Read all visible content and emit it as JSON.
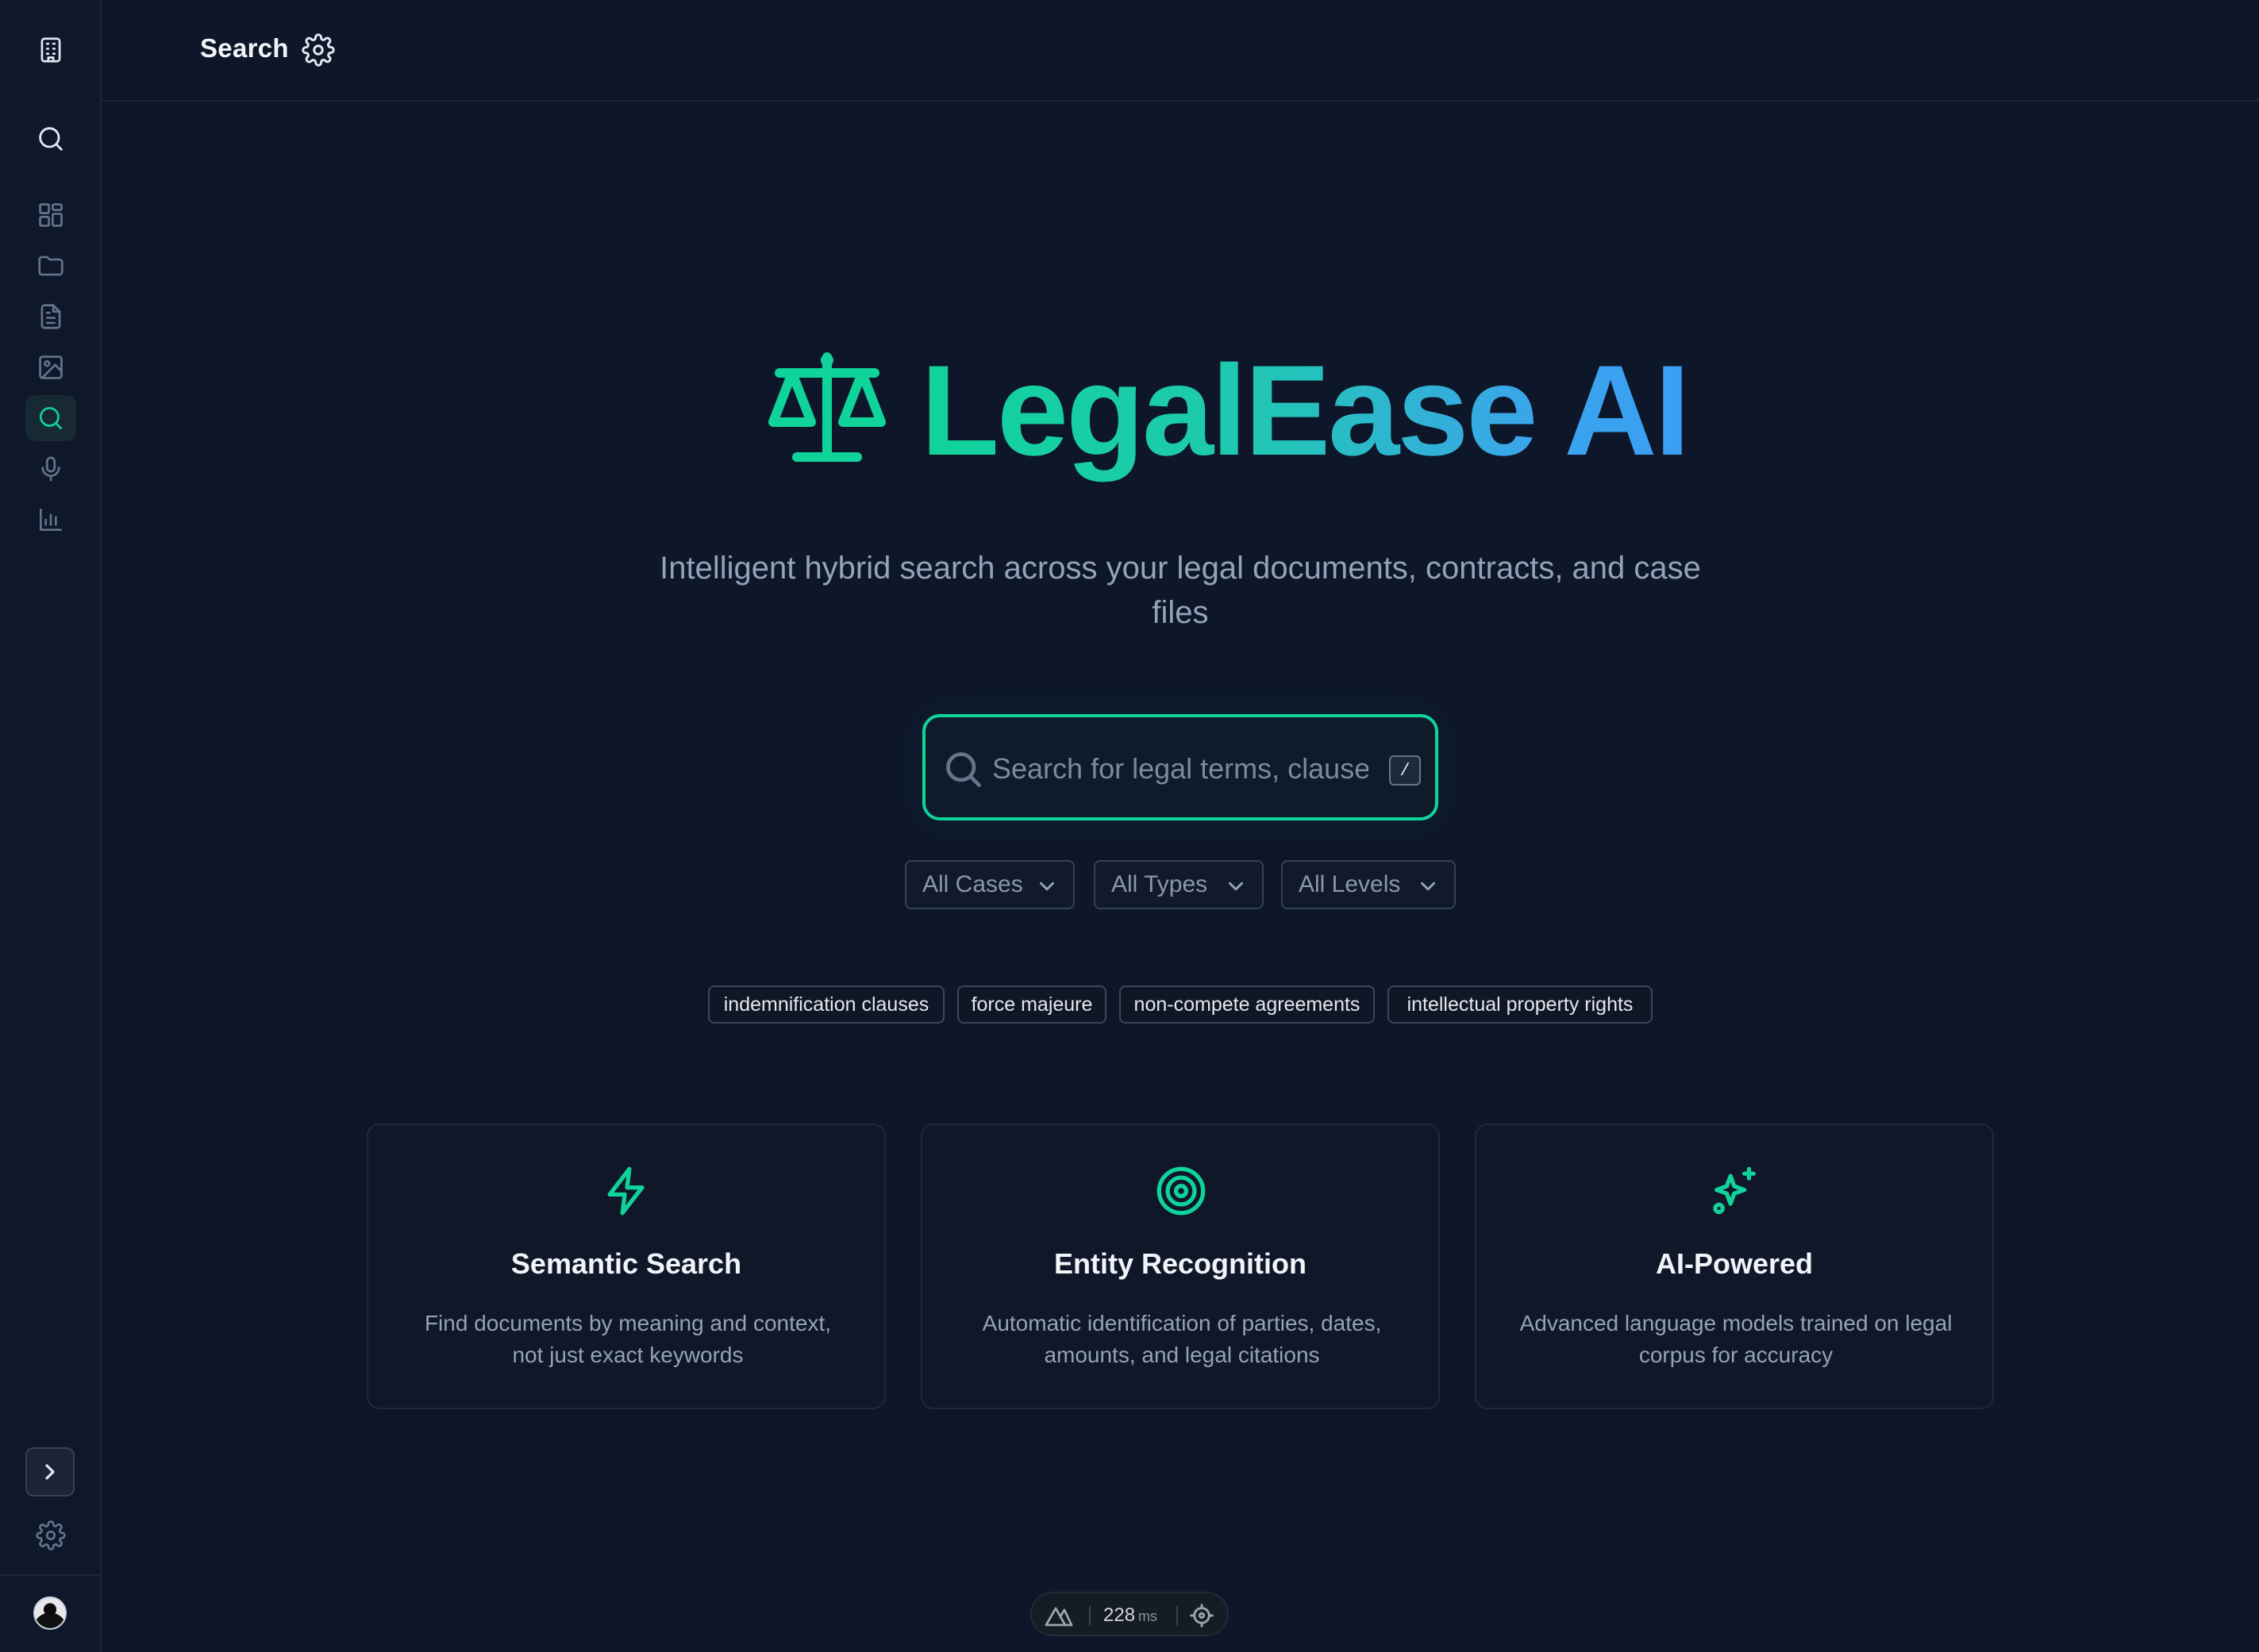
{
  "header": {
    "title": "Search"
  },
  "sidebar": {
    "items": [
      {
        "icon": "building-icon"
      },
      {
        "icon": "search-icon"
      },
      {
        "icon": "dashboard-icon"
      },
      {
        "icon": "folder-icon"
      },
      {
        "icon": "document-icon"
      },
      {
        "icon": "image-icon"
      },
      {
        "icon": "search-icon",
        "active": true
      },
      {
        "icon": "microphone-icon"
      },
      {
        "icon": "bar-chart-icon"
      }
    ],
    "bottom": [
      {
        "icon": "chevron-right-icon"
      },
      {
        "icon": "gear-icon"
      },
      {
        "icon": "avatar"
      }
    ]
  },
  "hero": {
    "title": "LegalEase AI",
    "subtitle": "Intelligent hybrid search across your legal documents, contracts, and case files"
  },
  "search": {
    "placeholder": "Search for legal terms, clauses",
    "value": "",
    "shortcut": "/"
  },
  "filters": [
    {
      "label": "All Cases"
    },
    {
      "label": "All Types"
    },
    {
      "label": "All Levels"
    }
  ],
  "suggestions": [
    "indemnification clauses",
    "force majeure",
    "non-compete agreements",
    "intellectual property rights"
  ],
  "features": [
    {
      "icon": "lightning-icon",
      "title": "Semantic Search",
      "description": "Find documents by meaning and context, not just exact keywords"
    },
    {
      "icon": "target-icon",
      "title": "Entity Recognition",
      "description": "Automatic identification of parties, dates, amounts, and legal citations"
    },
    {
      "icon": "sparkles-icon",
      "title": "AI-Powered",
      "description": "Advanced language models trained on legal corpus for accuracy"
    }
  ],
  "devtools": {
    "load_time": "228",
    "unit": "ms"
  },
  "colors": {
    "accent": "#10d39a",
    "accent_blue": "#3b9ef5",
    "background": "#0e1629",
    "sidebar": "#0f172a"
  }
}
